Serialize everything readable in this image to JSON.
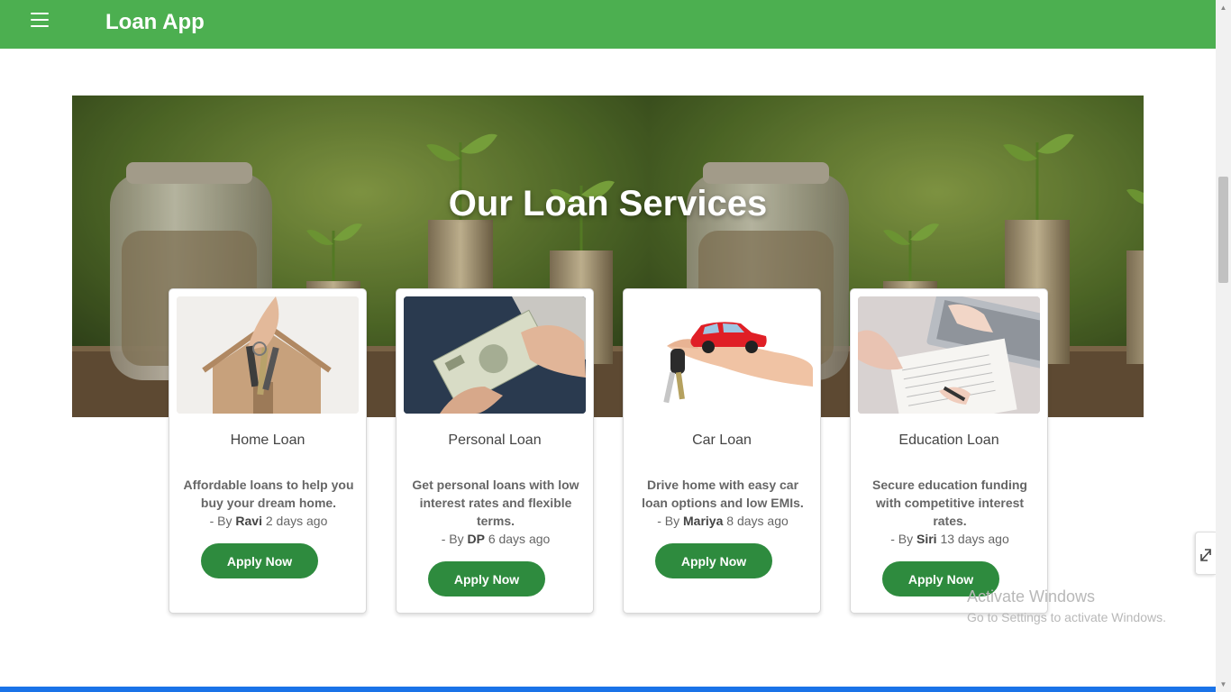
{
  "navbar": {
    "menu_icon": "hamburger-menu-icon",
    "title": "Loan App",
    "color": "#4caf50"
  },
  "hero": {
    "title": "Our Loan Services"
  },
  "cards": [
    {
      "image": "house-keys-photo",
      "title": "Home Loan",
      "description": "Affordable loans to help you buy your dream home.",
      "by_prefix": "- By",
      "author": "Ravi",
      "time": "2 days ago",
      "button": "Apply Now"
    },
    {
      "image": "cash-handover-photo",
      "title": "Personal Loan",
      "description": "Get personal loans with low interest rates and flexible terms.",
      "by_prefix": "- By",
      "author": "DP",
      "time": "6 days ago",
      "button": "Apply Now"
    },
    {
      "image": "toy-car-keys-photo",
      "title": "Car Loan",
      "description": "Drive home with easy car loan options and low EMIs.",
      "by_prefix": "- By",
      "author": "Mariya",
      "time": "8 days ago",
      "button": "Apply Now"
    },
    {
      "image": "laptop-paperwork-photo",
      "title": "Education Loan",
      "description": "Secure education funding with competitive interest rates.",
      "by_prefix": "- By",
      "author": "Siri",
      "time": "13 days ago",
      "button": "Apply Now"
    }
  ],
  "watermark": {
    "title": "Activate Windows",
    "subtitle": "Go to Settings to activate Windows."
  },
  "colors": {
    "accent": "#4caf50",
    "button": "#2e8b3e",
    "bottom_bar": "#1a73e8"
  }
}
